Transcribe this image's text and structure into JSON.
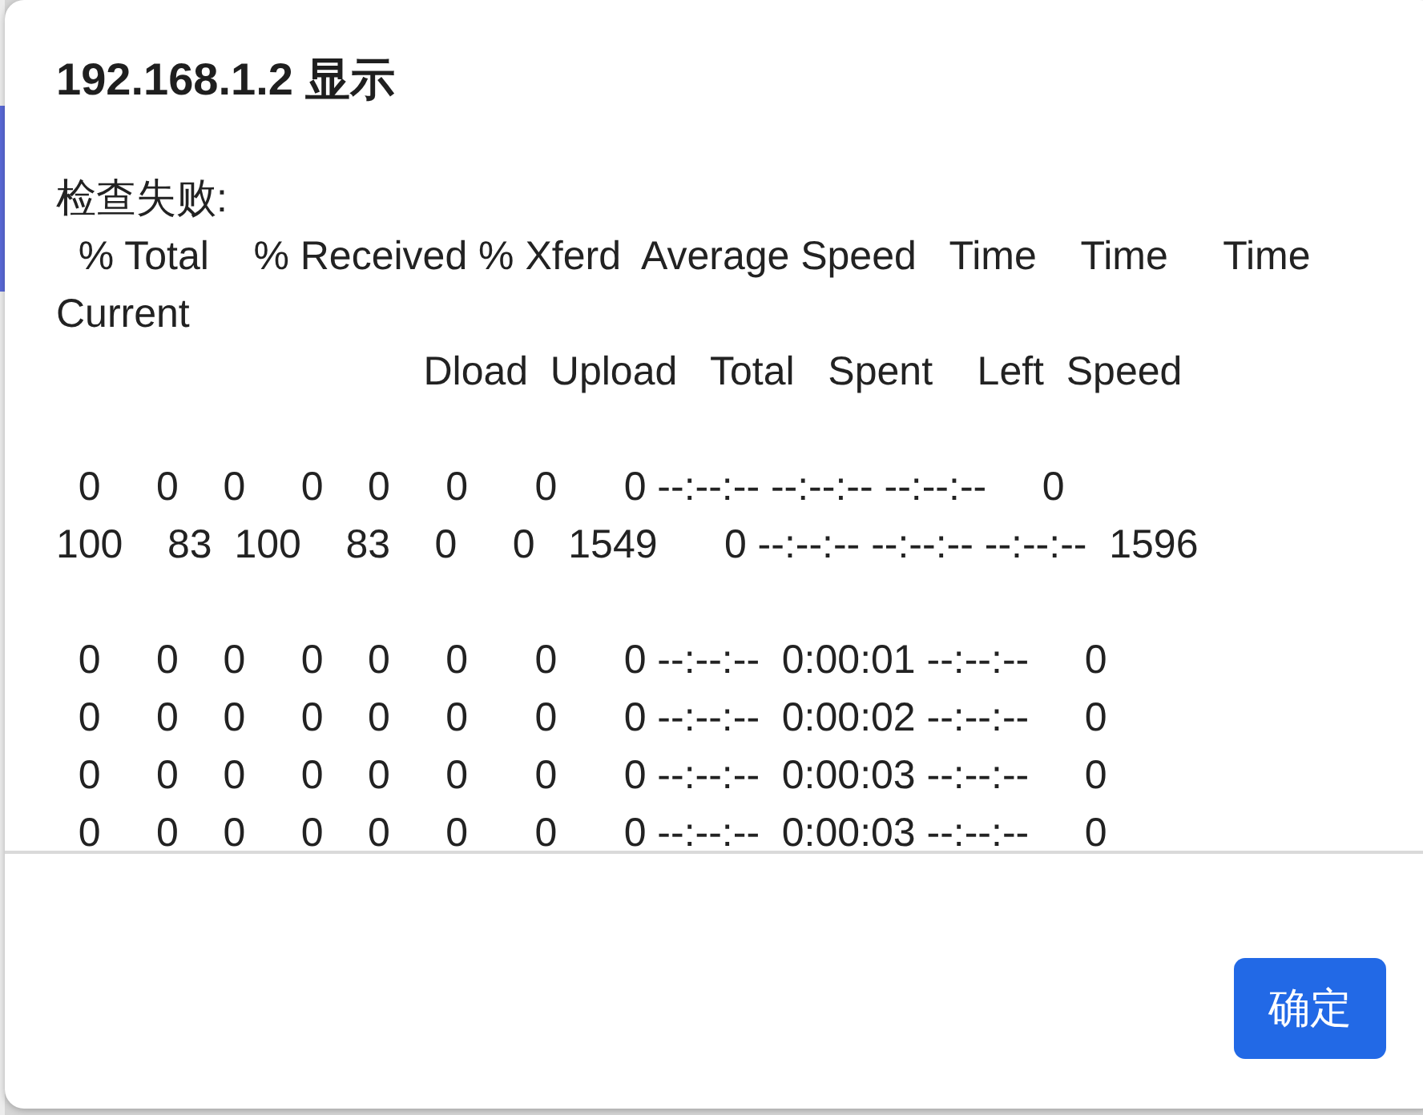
{
  "dialog": {
    "title": "192.168.1.2 显示",
    "message": {
      "heading": "检查失败:",
      "blocks": [
        [
          "  % Total    % Received % Xferd  Average Speed   Time    Time     Time",
          "Current",
          "                                 Dload  Upload   Total   Spent    Left  Speed"
        ],
        [
          "  0     0    0     0    0     0      0      0 --:--:-- --:--:-- --:--:--     0",
          "100    83  100    83    0     0   1549      0 --:--:-- --:--:-- --:--:--  1596"
        ],
        [
          "  0     0    0     0    0     0      0      0 --:--:--  0:00:01 --:--:--     0",
          "  0     0    0     0    0     0      0      0 --:--:--  0:00:02 --:--:--     0",
          "  0     0    0     0    0     0      0      0 --:--:--  0:00:03 --:--:--     0",
          "  0     0    0     0    0     0      0      0 --:--:--  0:00:03 --:--:--     0"
        ]
      ]
    },
    "buttons": [
      {
        "label": "确定"
      }
    ]
  }
}
